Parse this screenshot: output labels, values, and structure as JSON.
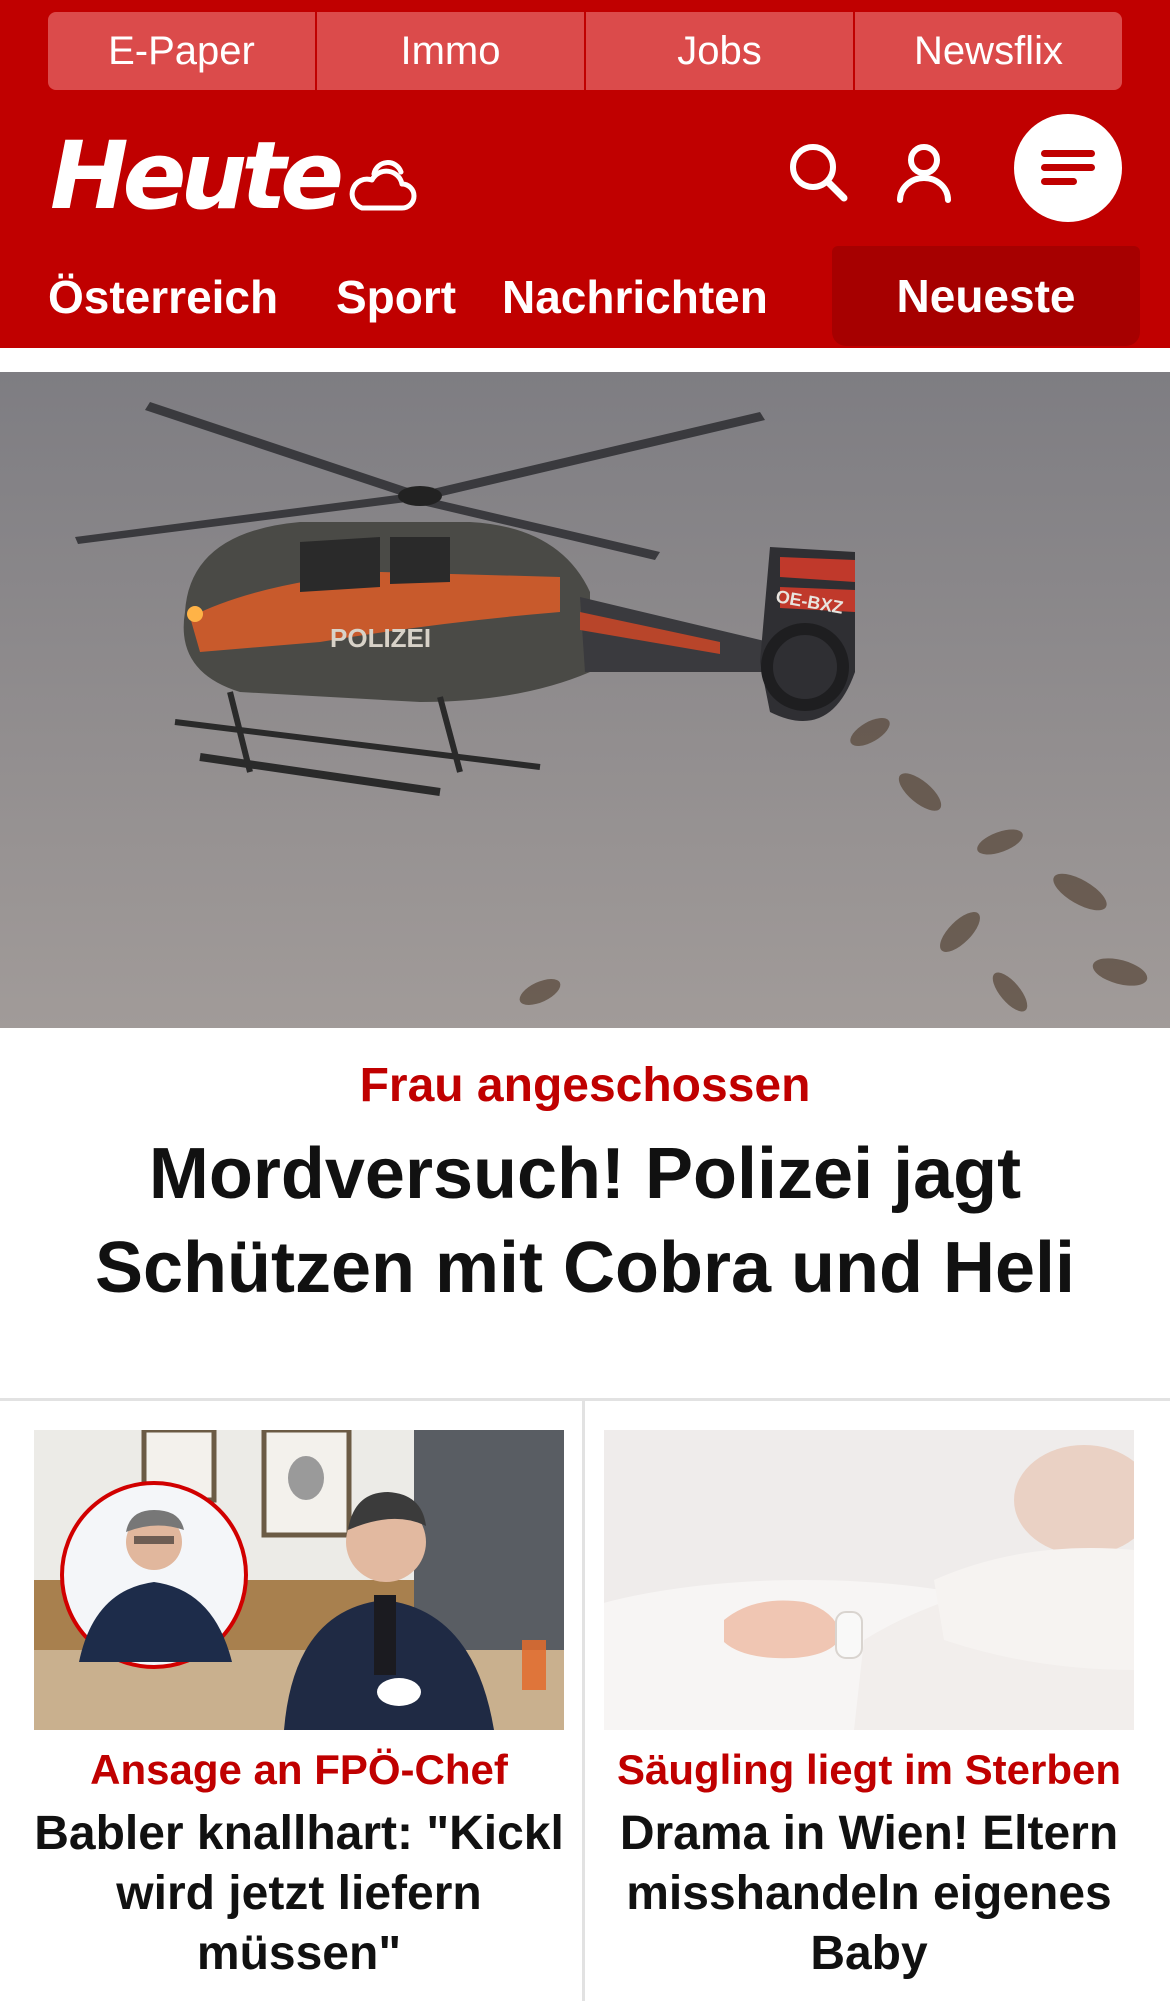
{
  "topbar": {
    "tabs": [
      "E-Paper",
      "Immo",
      "Jobs",
      "Newsflix"
    ]
  },
  "brand": {
    "logo_text": "Heute"
  },
  "icons": {
    "weather": "cloud-sun-icon",
    "search": "search-icon",
    "user": "user-icon",
    "menu": "menu-icon"
  },
  "nav": {
    "items": [
      "Österreich",
      "Sport",
      "Nachrichten"
    ],
    "active": "Neueste"
  },
  "hero": {
    "kicker": "Frau angeschossen",
    "headline": "Mordversuch! Polizei jagt Schützen mit Cobra und Heli",
    "image_text": [
      "POLIZEI",
      "OE-BXZ"
    ]
  },
  "cards": [
    {
      "kicker": "Ansage an FPÖ-Chef",
      "headline": "Babler knallhart: \"Kickl wird jetzt liefern müssen\""
    },
    {
      "kicker": "Säugling liegt im Sterben",
      "headline": "Drama in Wien! Eltern misshandeln eigenes Baby"
    }
  ],
  "colors": {
    "brand_red": "#c00000",
    "active_tab": "#a60000",
    "topbar_tab": "#db4b4b"
  }
}
